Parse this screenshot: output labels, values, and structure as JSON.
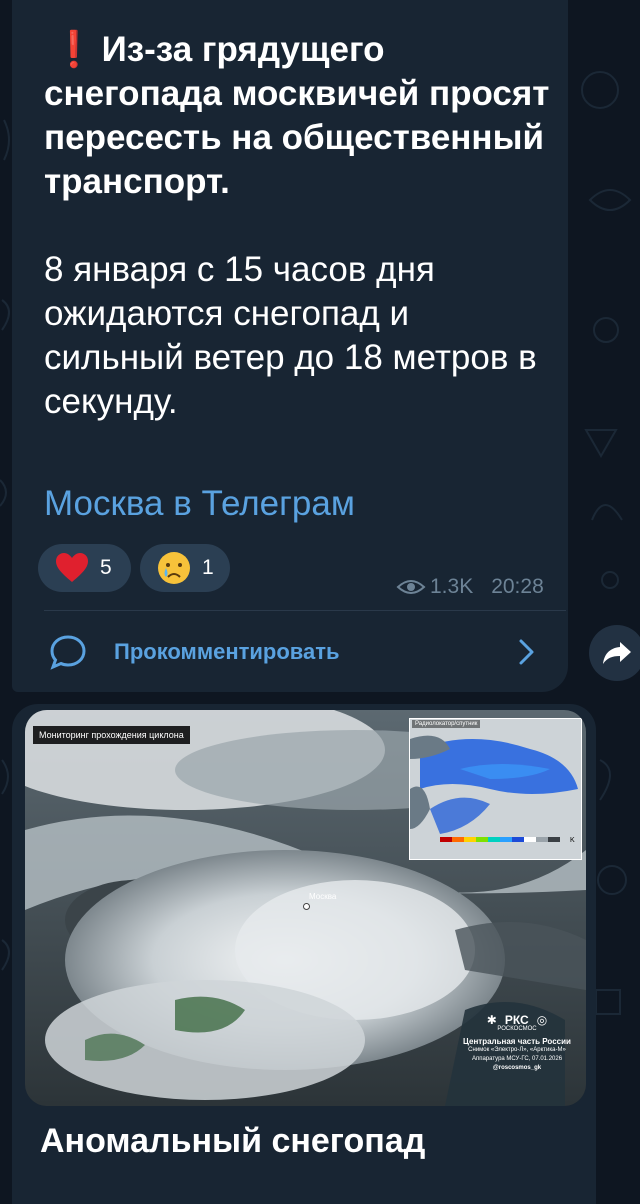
{
  "message": {
    "headline": "Из-за грядущего снегопада москвичей просят пересесть на общественный транспорт.",
    "body": "8 января с 15 часов дня ожидаются снегопад и сильный ветер до 18 метров в секунду.",
    "source_link": "Москва в Телеграм",
    "reactions": [
      {
        "emoji": "heart",
        "count": "5"
      },
      {
        "emoji": "crying-face",
        "count": "1"
      }
    ],
    "views": "1.3K",
    "time": "20:28",
    "comment_label": "Прокомментировать"
  },
  "photo": {
    "caption": "Мониторинг прохождения циклона",
    "inset_title": "Радиолокатор/спутник",
    "inset_unit": "K",
    "city_label": "Москва",
    "logo_abbr": "РКС",
    "logo_brand": "РОСКОСМОС",
    "logo_region": "Центральная часть России",
    "logo_instrument": "Снимок «Электро-Л», «Арктика-М»",
    "logo_date": "Аппаратура МСУ-ГС, 07.01.2026",
    "logo_handle": "@roscosmos_gk"
  },
  "next_post": {
    "title": "Аномальный снегопад"
  }
}
